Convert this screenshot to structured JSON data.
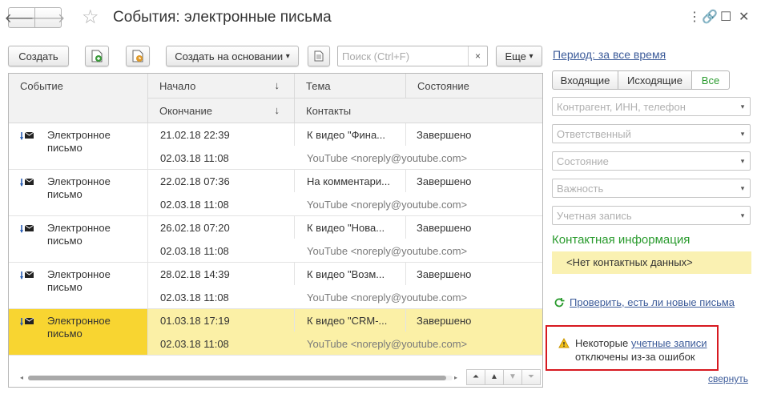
{
  "window": {
    "title": "События: электронные письма",
    "back_icon": "🡐",
    "forward_icon": "🡒",
    "star_icon": "☆",
    "menu_icon": "⋮",
    "link_icon": "🔗",
    "max_icon": "☐",
    "close_icon": "✕"
  },
  "toolbar": {
    "create_label": "Создать",
    "create_based_label": "Создать на основании",
    "create_based_arrow": "▾",
    "search_placeholder": "Поиск (Ctrl+F)",
    "search_clear": "×",
    "more_label": "Еще",
    "more_arrow": "▾"
  },
  "table": {
    "headers": {
      "event": "Событие",
      "start": "Начало",
      "end": "Окончание",
      "subject": "Тема",
      "state": "Состояние",
      "contacts": "Контакты",
      "sort_arrow": "↓"
    },
    "rows": [
      {
        "event": "Электронное письмо",
        "start": "21.02.18 22:39",
        "end": "02.03.18 11:08",
        "subject": "К видео \"Фина...",
        "state": "Завершено",
        "contact": "YouTube <noreply@youtube.com>"
      },
      {
        "event": "Электронное письмо",
        "start": "22.02.18 07:36",
        "end": "02.03.18 11:08",
        "subject": "На комментари...",
        "state": "Завершено",
        "contact": "YouTube <noreply@youtube.com>"
      },
      {
        "event": "Электронное письмо",
        "start": "26.02.18 07:20",
        "end": "02.03.18 11:08",
        "subject": "К видео \"Нова...",
        "state": "Завершено",
        "contact": "YouTube <noreply@youtube.com>"
      },
      {
        "event": "Электронное письмо",
        "start": "28.02.18 14:39",
        "end": "02.03.18 11:08",
        "subject": "К видео \"Возм...",
        "state": "Завершено",
        "contact": "YouTube <noreply@youtube.com>"
      },
      {
        "event": "Электронное письмо",
        "start": "01.03.18 17:19",
        "end": "02.03.18 11:08",
        "subject": "К видео \"CRM-...",
        "state": "Завершено",
        "contact": "YouTube <noreply@youtube.com>"
      }
    ],
    "scroll_first": "⏶",
    "scroll_up": "▲",
    "scroll_down": "▼",
    "scroll_last": "⏷"
  },
  "panel": {
    "period_label": "Период: за все время",
    "tabs": [
      "Входящие",
      "Исходящие",
      "Все"
    ],
    "filters": [
      "Контрагент, ИНН, телефон",
      "Ответственный",
      "Состояние",
      "Важность",
      "Учетная запись"
    ],
    "dropdown_arrow": "▾",
    "contact_title": "Контактная информация",
    "contact_value": "<Нет контактных данных>",
    "check_mail_link": "Проверить, есть ли новые письма",
    "warning_prefix": "Некоторые ",
    "warning_link": "учетные записи",
    "warning_suffix": "отключены из-за ошибок",
    "collapse_link": "свернуть"
  },
  "colors": {
    "accent_green": "#2a9b2e",
    "selection_row": "#fbf0a6",
    "selection_cell": "#f8d531",
    "warning_border": "#d71920",
    "link": "#3d5c9a"
  }
}
